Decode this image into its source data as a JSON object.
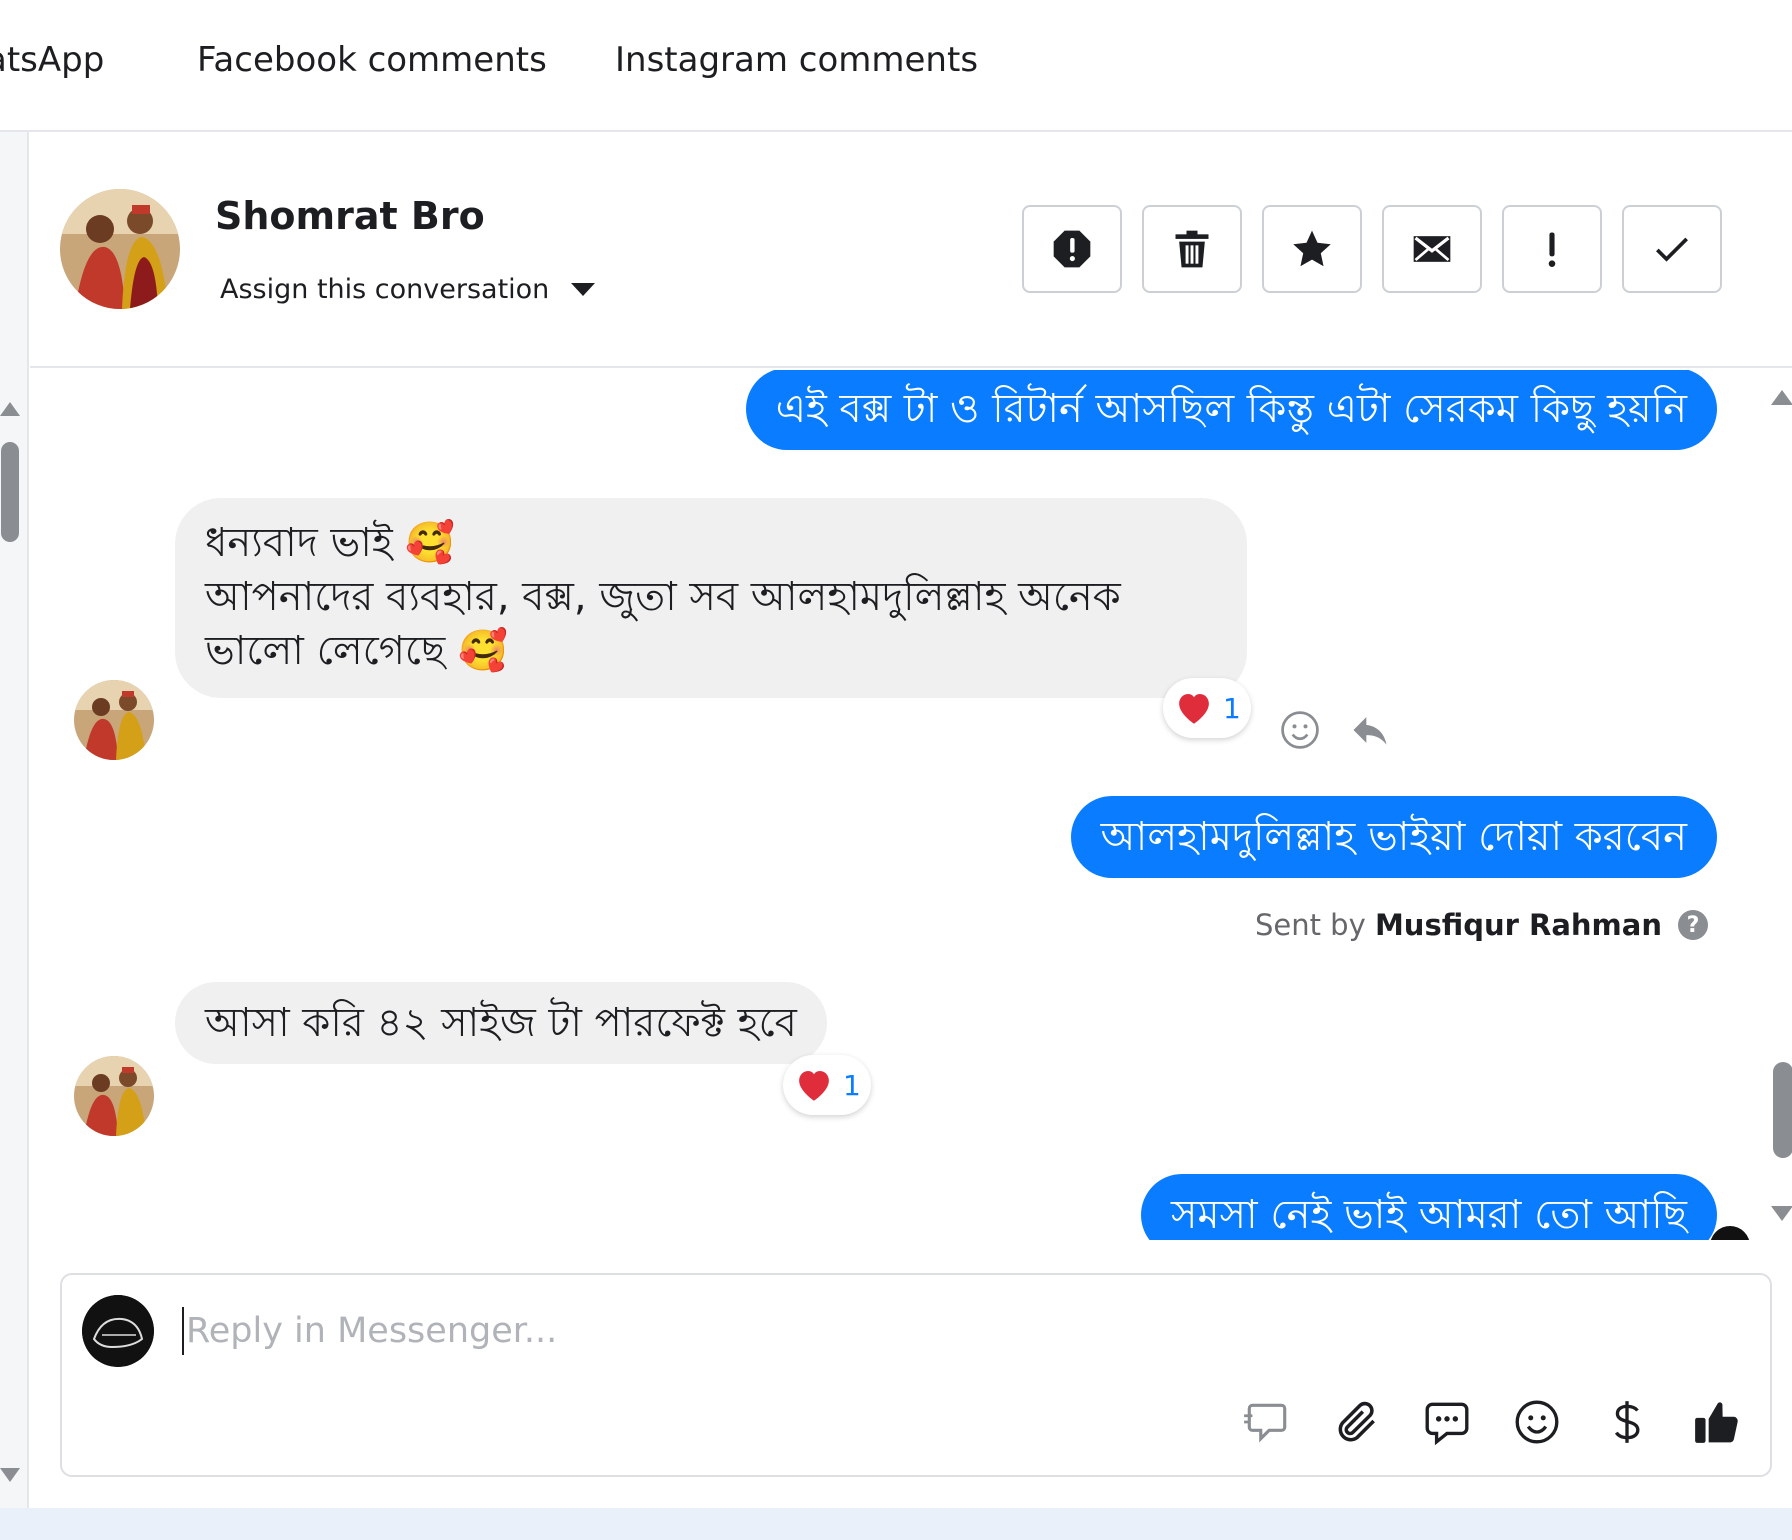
{
  "tabs": [
    {
      "label": "atsApp"
    },
    {
      "label": "Facebook comments"
    },
    {
      "label": "Instagram comments"
    }
  ],
  "header": {
    "name": "Shomrat Bro",
    "assign_label": "Assign this conversation",
    "actions": [
      "spam-icon",
      "trash-icon",
      "star-icon",
      "envelope-icon",
      "exclamation-icon",
      "check-icon"
    ]
  },
  "messages": [
    {
      "direction": "outgoing",
      "text": "এই বক্স টা ও রিটার্ন আসছিল কিন্তু এটা সেরকম কিছু হয়নি"
    },
    {
      "direction": "incoming",
      "lines": [
        "ধন্যবাদ ভাই 🥰",
        "আপনাদের ব্যবহার, বক্স,  জুতা সব আলহামদুলিল্লাহ অনেক ভালো লেগেছে 🥰"
      ],
      "reaction": {
        "emoji": "heart",
        "count": "1"
      }
    },
    {
      "direction": "outgoing",
      "text": "আলহামদুলিল্লাহ ভাইয়া দোয়া করবেন",
      "sent_by_prefix": "Sent by",
      "sent_by_name": "Musfiqur Rahman"
    },
    {
      "direction": "incoming",
      "text": "আসা করি ৪২ সাইজ টা পারফেক্ট হবে",
      "reaction": {
        "emoji": "heart",
        "count": "1"
      }
    },
    {
      "direction": "outgoing",
      "text": "সমসা নেই ভাই আমরা তো আছি"
    }
  ],
  "help_glyph": "?",
  "composer": {
    "placeholder": "Reply in Messenger...",
    "tools": [
      "quick-reply-icon",
      "attachment-icon",
      "saved-reply-icon",
      "emoji-icon",
      "dollar-icon",
      "thumbs-up-icon"
    ]
  },
  "colors": {
    "outgoing_bubble": "#0a7cff",
    "incoming_bubble": "#f0f0f0",
    "reaction_heart": "#e02d3c"
  }
}
